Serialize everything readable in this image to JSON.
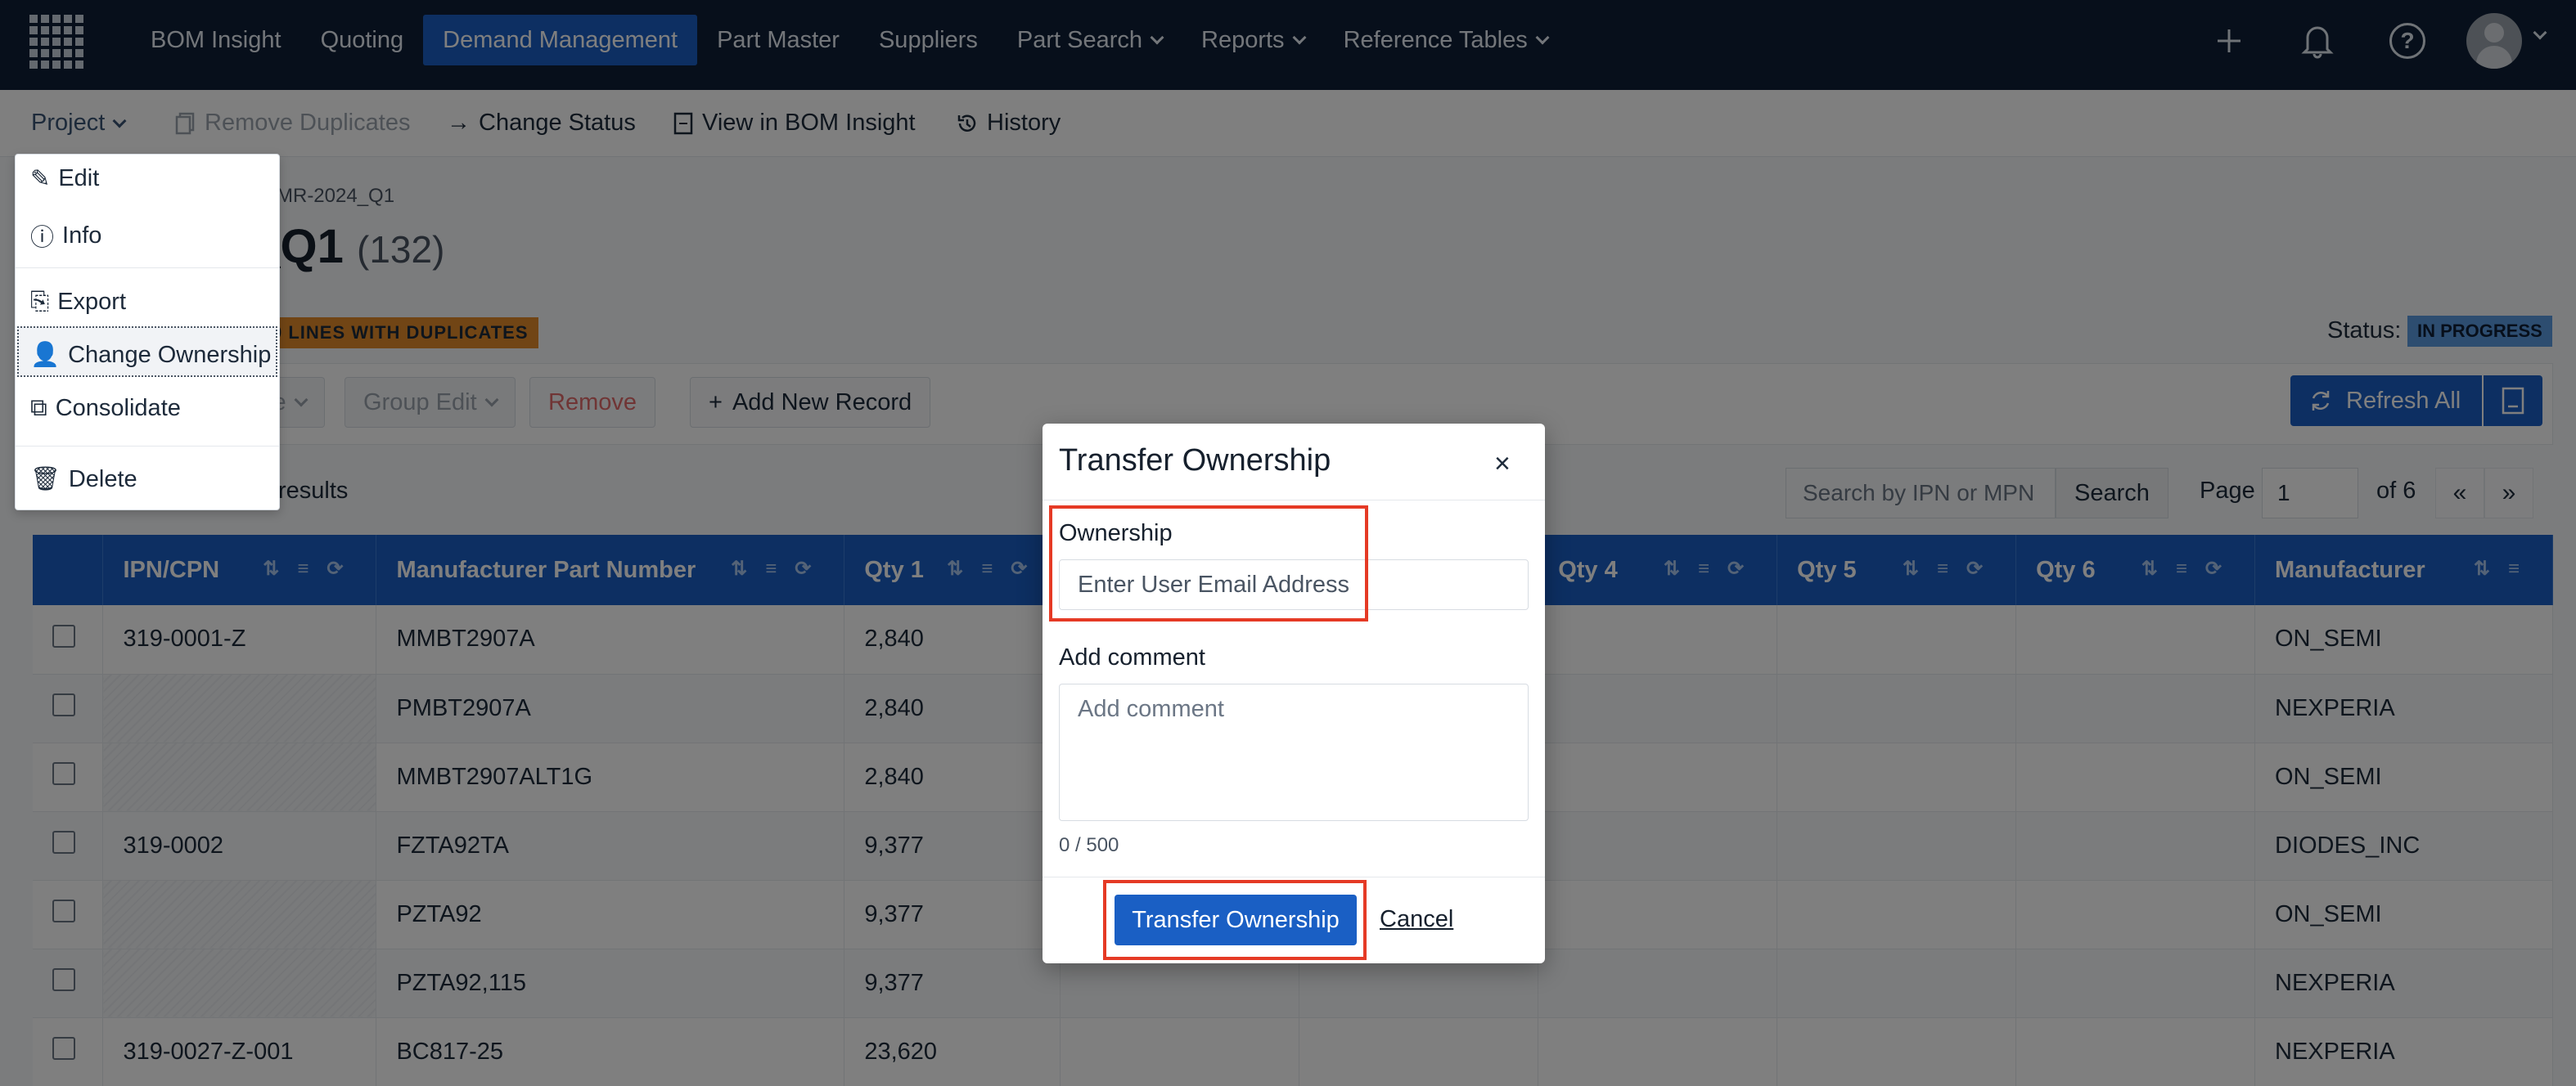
{
  "nav": {
    "items": [
      {
        "label": "BOM Insight",
        "active": false,
        "dropdown": false
      },
      {
        "label": "Quoting",
        "active": false,
        "dropdown": false
      },
      {
        "label": "Demand Management",
        "active": true,
        "dropdown": false
      },
      {
        "label": "Part Master",
        "active": false,
        "dropdown": false
      },
      {
        "label": "Suppliers",
        "active": false,
        "dropdown": false
      },
      {
        "label": "Part Search",
        "active": false,
        "dropdown": true
      },
      {
        "label": "Reports",
        "active": false,
        "dropdown": true
      },
      {
        "label": "Reference Tables",
        "active": false,
        "dropdown": true
      }
    ]
  },
  "toolbar": {
    "project": "Project",
    "remove_duplicates": "Remove Duplicates",
    "change_status": "Change Status",
    "view_in_bom": "View in BOM Insight",
    "history": "History"
  },
  "project_menu": {
    "edit": "Edit",
    "info": "Info",
    "export": "Export",
    "change_ownership": "Change Ownership",
    "consolidate": "Consolidate",
    "delete": "Delete"
  },
  "page": {
    "breadcrumb": "MMR-2024_Q1",
    "title": "4_Q1",
    "count": "(132)",
    "dup_badge": "0 LINES WITH DUPLICATES",
    "status_label": "Status:",
    "status_value": "IN PROGRESS"
  },
  "actions": {
    "move": "ve",
    "group_edit": "Group Edit",
    "remove": "Remove",
    "add_new": "Add New Record",
    "refresh_all": "Refresh All"
  },
  "results_label": "results",
  "search": {
    "placeholder": "Search by IPN or MPN",
    "button": "Search"
  },
  "pager": {
    "label": "Page",
    "current": "1",
    "of": "of 6",
    "prev": "«",
    "next": "»"
  },
  "table": {
    "columns": [
      "IPN/CPN",
      "Manufacturer Part Number",
      "Qty 1",
      "",
      "",
      "Qty 4",
      "Qty 5",
      "Qty 6",
      "Manufacturer"
    ],
    "rows": [
      {
        "ipn": "319-0001-Z",
        "mpn": "MMBT2907A",
        "qty1": "2,840",
        "mfr": "ON_SEMI"
      },
      {
        "ipn": "",
        "mpn": "PMBT2907A",
        "qty1": "2,840",
        "mfr": "NEXPERIA"
      },
      {
        "ipn": "",
        "mpn": "MMBT2907ALT1G",
        "qty1": "2,840",
        "mfr": "ON_SEMI"
      },
      {
        "ipn": "319-0002",
        "mpn": "FZTA92TA",
        "qty1": "9,377",
        "mfr": "DIODES_INC"
      },
      {
        "ipn": "",
        "mpn": "PZTA92",
        "qty1": "9,377",
        "mfr": "ON_SEMI"
      },
      {
        "ipn": "",
        "mpn": "PZTA92,115",
        "qty1": "9,377",
        "mfr": "NEXPERIA"
      },
      {
        "ipn": "319-0027-Z-001",
        "mpn": "BC817-25",
        "qty1": "23,620",
        "mfr": "NEXPERIA"
      }
    ]
  },
  "modal": {
    "title": "Transfer Ownership",
    "ownership_label": "Ownership",
    "email_placeholder": "Enter User Email Address",
    "comment_label": "Add comment",
    "comment_placeholder": "Add comment",
    "char_count": "0 / 500",
    "transfer_button": "Transfer Ownership",
    "cancel": "Cancel"
  },
  "colors": {
    "nav_bg": "#0f1f36",
    "accent": "#1a5fc4",
    "highlight": "#e53a25",
    "dup_badge": "#e38b2a",
    "status_badge": "#5b9be0"
  }
}
